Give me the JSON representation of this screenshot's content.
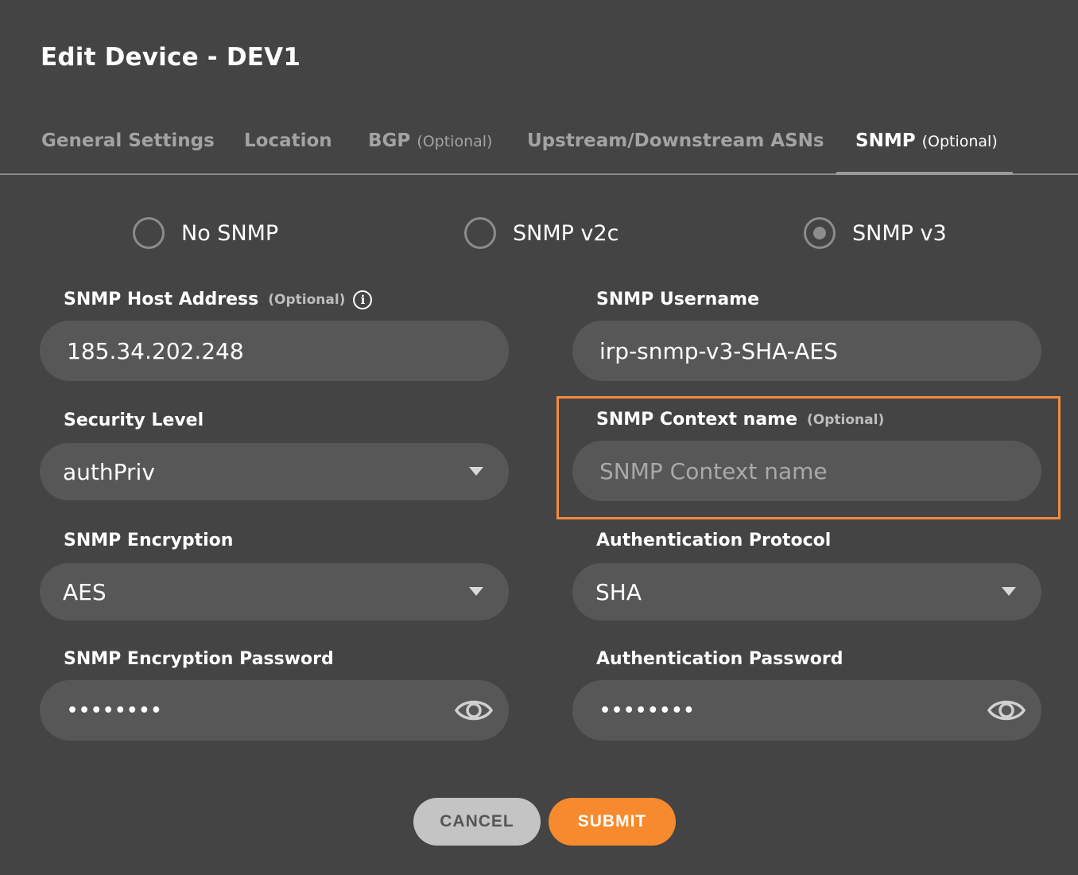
{
  "dialog": {
    "title": "Edit Device - DEV1"
  },
  "tabs": [
    {
      "label": "General Settings",
      "optional": ""
    },
    {
      "label": "Location",
      "optional": ""
    },
    {
      "label": "BGP",
      "optional": "(Optional)"
    },
    {
      "label": "Upstream/Downstream ASNs",
      "optional": ""
    },
    {
      "label": "SNMP",
      "optional": "(Optional)",
      "active": true
    }
  ],
  "snmp_version": {
    "options": [
      "No SNMP",
      "SNMP v2c",
      "SNMP v3"
    ],
    "selected": "SNMP v3"
  },
  "fields": {
    "host_address": {
      "label": "SNMP Host Address",
      "optional": "(Optional)",
      "value": "185.34.202.248"
    },
    "username": {
      "label": "SNMP Username",
      "value": "irp-snmp-v3-SHA-AES"
    },
    "security_level": {
      "label": "Security Level",
      "value": "authPriv"
    },
    "context_name": {
      "label": "SNMP Context name",
      "optional": "(Optional)",
      "value": "",
      "placeholder": "SNMP Context name"
    },
    "encryption": {
      "label": "SNMP Encryption",
      "value": "AES"
    },
    "auth_protocol": {
      "label": "Authentication Protocol",
      "value": "SHA"
    },
    "encryption_password": {
      "label": "SNMP Encryption Password",
      "value": "••••••••"
    },
    "auth_password": {
      "label": "Authentication Password",
      "value": "••••••••"
    }
  },
  "buttons": {
    "cancel": "CANCEL",
    "submit": "SUBMIT"
  },
  "colors": {
    "accent": "#f78a2e",
    "background": "#444444",
    "input": "#575757"
  }
}
